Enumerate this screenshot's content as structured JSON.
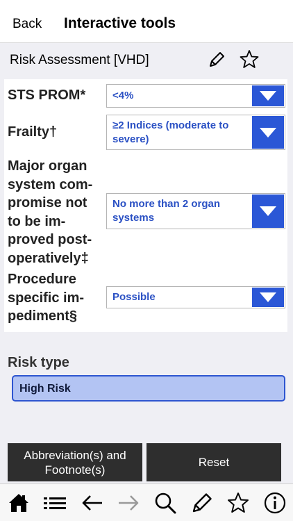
{
  "navbar": {
    "back_label": "Back",
    "title": "Interactive tools"
  },
  "subheader": {
    "title": "Risk Assessment [VHD]"
  },
  "form": {
    "rows": [
      {
        "label": "STS PROM*",
        "value": "<4%"
      },
      {
        "label": "Frailty†",
        "value": "≥2 Indices (moderate to severe)"
      },
      {
        "label_lines": [
          "Major organ",
          "system com-",
          "promise not",
          "to be im-",
          "proved post-",
          "operatively‡"
        ],
        "value": "No more than 2 organ systems"
      },
      {
        "label_lines": [
          "Procedure",
          "specific im-",
          "pediment§"
        ],
        "value": "Possible"
      }
    ]
  },
  "risk": {
    "label": "Risk type",
    "value": "High Risk"
  },
  "buttons": {
    "abbrev_lines": [
      "Abbreviation(s) and",
      "Footnote(s)"
    ],
    "reset_label": "Reset"
  },
  "colors": {
    "accent": "#2b57d6",
    "select_text": "#2b51c4",
    "risk_fill": "#b3c4f3",
    "button_bg": "#2e2e2e"
  },
  "toolbar": {
    "icons": [
      "home-icon",
      "list-icon",
      "arrow-left-icon",
      "arrow-right-icon",
      "search-icon",
      "pencil-icon",
      "star-icon",
      "info-icon"
    ]
  }
}
